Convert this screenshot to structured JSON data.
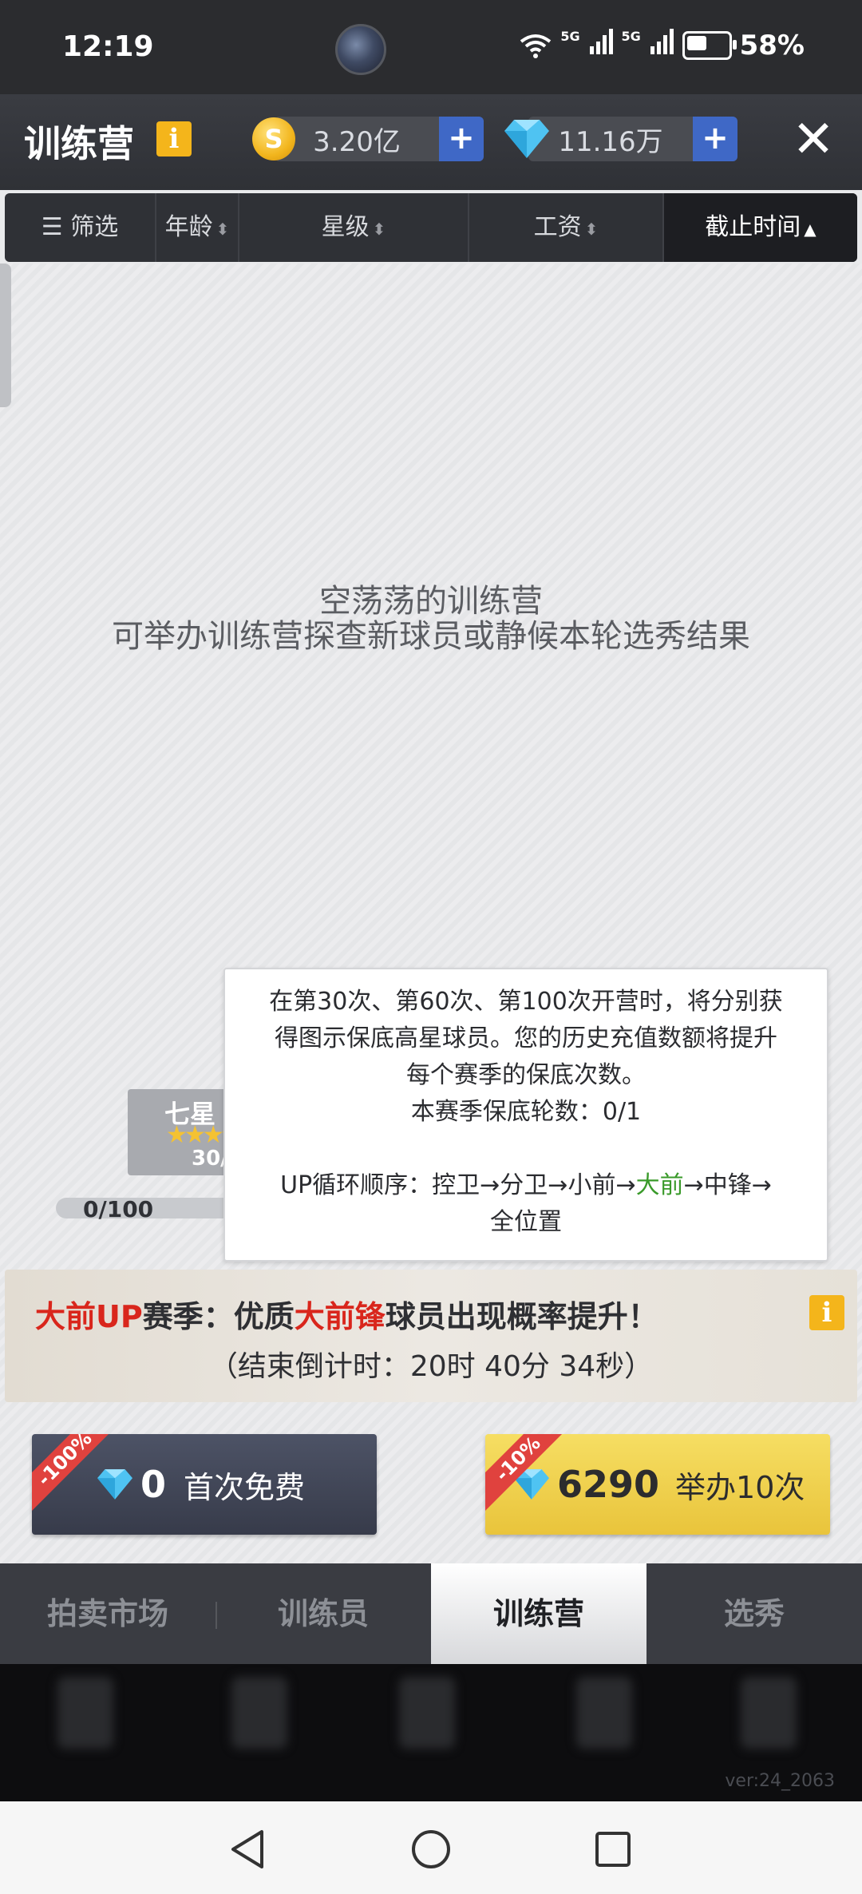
{
  "status_bar": {
    "time": "12:19",
    "network1": "5G",
    "network2": "5G",
    "battery": "58%"
  },
  "header": {
    "title": "训练营",
    "info_icon": "i",
    "coins": "3.20亿",
    "diamonds": "11.16万",
    "plus": "+",
    "close": "✕"
  },
  "filters": {
    "filter": "筛选",
    "age": "年龄",
    "stars": "星级",
    "salary": "工资",
    "deadline": "截止时间"
  },
  "empty_state": {
    "title": "空荡荡的训练营",
    "subtitle": "可举办训练营探查新球员或静候本轮选秀结果"
  },
  "star_card": {
    "title": "七星",
    "count": "30/",
    "progress_label": "0/100"
  },
  "tooltip": {
    "line1": "在第30次、第60次、第100次开营时，将分别获",
    "line2": "得图示保底高星球员。您的历史充值数额将提升",
    "line3": "每个赛季的保底次数。",
    "line4": "本赛季保底轮数：0/1",
    "line5_prefix": "UP循环顺序：控卫→分卫→小前→",
    "line5_highlight": "大前",
    "line5_suffix": "→中锋→",
    "line6": "全位置"
  },
  "season_banner": {
    "part1": "大前UP",
    "part2": "赛季：优质",
    "part3": "大前锋",
    "part4": "球员出现概率提升！",
    "countdown": "（结束倒计时：20时 40分 34秒）",
    "info_icon": "i"
  },
  "buttons": {
    "free": {
      "ribbon": "-100%",
      "amount": "0",
      "label": "首次免费"
    },
    "ten": {
      "ribbon": "-10%",
      "amount": "6290",
      "label": "举办10次"
    }
  },
  "tabs": [
    "拍卖市场",
    "训练员",
    "训练营",
    "选秀"
  ],
  "active_tab": "训练营",
  "version": "ver:24_2063",
  "colors": {
    "accent_blue": "#3f68c6",
    "gold": "#f4b51b",
    "highlight_red": "#d9261c",
    "highlight_green": "#3a9a2a"
  },
  "icons": {
    "coin": "coin-icon",
    "diamond": "diamond-icon",
    "filter": "filter-sliders-icon",
    "sort": "sort-arrows-icon",
    "close": "close-icon",
    "info": "info-icon",
    "back": "back-triangle-icon",
    "home": "home-circle-icon",
    "recents": "recents-square-icon"
  }
}
